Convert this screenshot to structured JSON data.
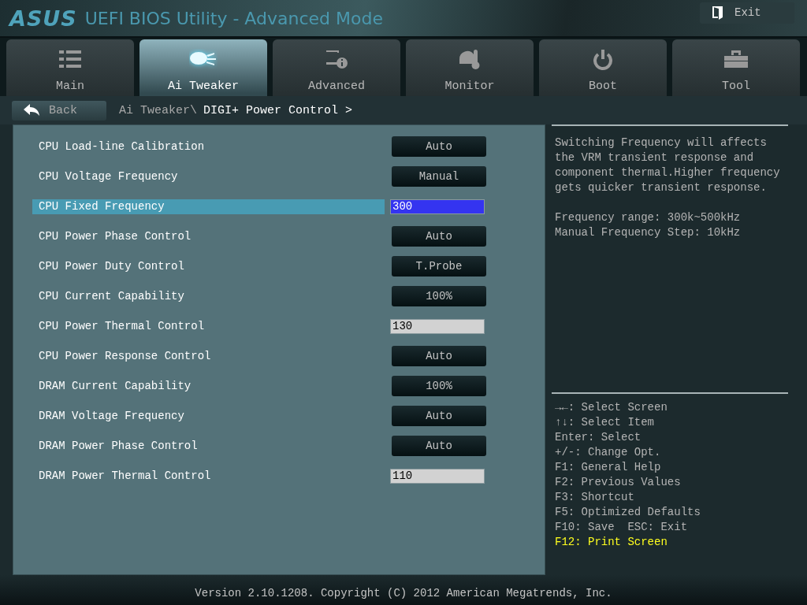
{
  "header": {
    "logo": "ASUS",
    "title": "UEFI BIOS Utility - Advanced Mode",
    "exit_button": "Exit"
  },
  "tabs": [
    {
      "label": "Main",
      "selected": false
    },
    {
      "label": "Ai Tweaker",
      "selected": true
    },
    {
      "label": "Advanced",
      "selected": false
    },
    {
      "label": "Monitor",
      "selected": false
    },
    {
      "label": "Boot",
      "selected": false
    },
    {
      "label": "Tool",
      "selected": false
    }
  ],
  "back_button": "Back",
  "breadcrumb": {
    "parent": "Ai Tweaker\\",
    "current": "DIGI+ Power Control >"
  },
  "settings": [
    {
      "label": "CPU Load-line Calibration",
      "kind": "dropdown",
      "value": "Auto",
      "selected": false
    },
    {
      "label": "CPU Voltage Frequency",
      "kind": "dropdown",
      "value": "Manual",
      "selected": false
    },
    {
      "label": "CPU Fixed Frequency",
      "kind": "number",
      "value": "300",
      "selected": true
    },
    {
      "label": "CPU Power Phase Control",
      "kind": "dropdown",
      "value": "Auto",
      "selected": false
    },
    {
      "label": "CPU Power Duty Control",
      "kind": "dropdown",
      "value": "T.Probe",
      "selected": false
    },
    {
      "label": "CPU Current Capability",
      "kind": "dropdown",
      "value": "100%",
      "selected": false
    },
    {
      "label": "CPU Power Thermal Control",
      "kind": "number",
      "value": "130",
      "selected": false
    },
    {
      "label": "CPU Power Response Control",
      "kind": "dropdown",
      "value": "Auto",
      "selected": false
    },
    {
      "label": "DRAM Current Capability",
      "kind": "dropdown",
      "value": "100%",
      "selected": false
    },
    {
      "label": "DRAM Voltage Frequency",
      "kind": "dropdown",
      "value": "Auto",
      "selected": false
    },
    {
      "label": "DRAM Power Phase Control",
      "kind": "dropdown",
      "value": "Auto",
      "selected": false
    },
    {
      "label": "DRAM Power Thermal Control",
      "kind": "number",
      "value": "110",
      "selected": false
    }
  ],
  "help": {
    "description": [
      "Switching Frequency will affects the VRM transient response and component thermal.Higher frequency gets quicker transient response.",
      "Frequency range: 300k~500kHz\nManual Frequency Step: 10kHz"
    ],
    "keys": [
      {
        "text": "→←: Select Screen",
        "highlighted": false
      },
      {
        "text": "↑↓: Select Item",
        "highlighted": false
      },
      {
        "text": "Enter: Select",
        "highlighted": false
      },
      {
        "text": "+/-: Change Opt.",
        "highlighted": false
      },
      {
        "text": "F1: General Help",
        "highlighted": false
      },
      {
        "text": "F2: Previous Values",
        "highlighted": false
      },
      {
        "text": "F3: Shortcut",
        "highlighted": false
      },
      {
        "text": "F5: Optimized Defaults",
        "highlighted": false
      },
      {
        "text": "F10: Save  ESC: Exit",
        "highlighted": false
      },
      {
        "text": "F12: Print Screen",
        "highlighted": true
      }
    ]
  },
  "footer": "Version 2.10.1208. Copyright (C) 2012 American Megatrends, Inc."
}
